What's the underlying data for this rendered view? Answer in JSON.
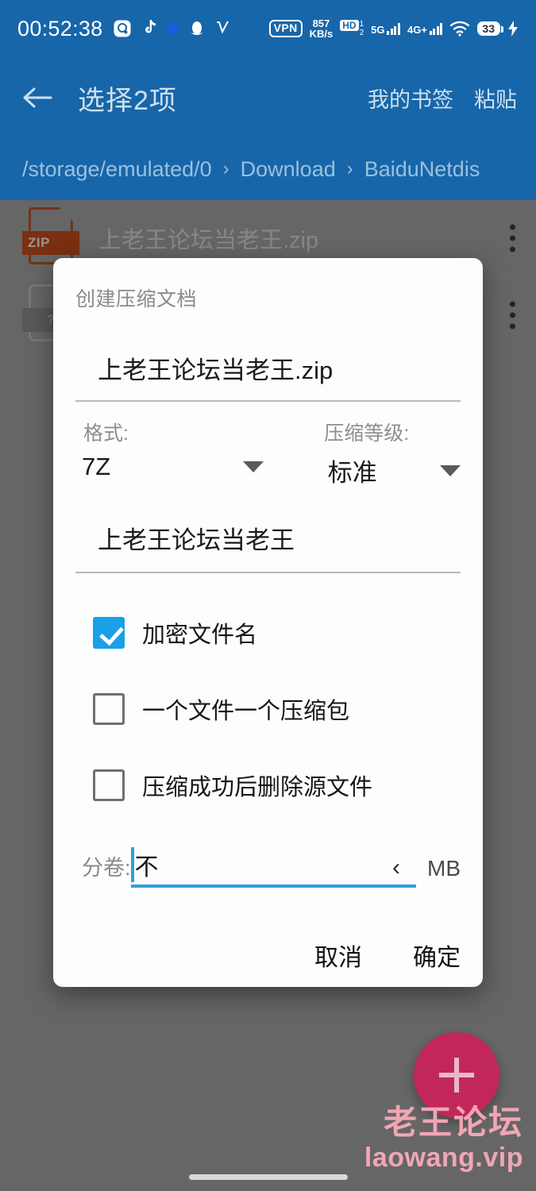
{
  "statusbar": {
    "time": "00:52:38",
    "left_icons": [
      "camera-app-icon",
      "tiktok-icon",
      "dot-badge-icon",
      "qq-icon",
      "v-app-icon"
    ],
    "vpn": "VPN",
    "netspeed_value": "857",
    "netspeed_unit": "KB/s",
    "hd_label": "HD",
    "hd_sup": "1",
    "hd_sub": "2",
    "sim1_label": "5G",
    "sim2_label": "4G+",
    "wifi_icon": "wifi-icon",
    "battery": "33",
    "charging_icon": "bolt-icon"
  },
  "appbar": {
    "back_icon": "back-arrow-icon",
    "title": "选择2项",
    "actions": [
      "我的书签",
      "粘贴"
    ]
  },
  "breadcrumb": {
    "separator": "›",
    "items": [
      "/storage/emulated/0",
      "Download",
      "BaiduNetdis"
    ]
  },
  "filelist": {
    "rows": [
      {
        "name": "上老王论坛当老王.zip",
        "icon": "zip-file-icon",
        "icon_tag": "ZIP",
        "menu_icon": "overflow-menu-icon"
      },
      {
        "name": "",
        "icon": "unknown-file-icon",
        "icon_tag": "?",
        "menu_icon": "overflow-menu-icon"
      }
    ]
  },
  "fab": {
    "icon": "plus-icon",
    "color": "#c2275c"
  },
  "watermark": {
    "cn": "老王论坛",
    "en": "laowang.vip",
    "color": "#f0a6b4"
  },
  "dialog": {
    "title": "创建压缩文档",
    "archive_name": "上老王论坛当老王.zip",
    "archive_name_placeholder": "",
    "format": {
      "label": "格式:",
      "value": "7Z",
      "caret_icon": "chevron-down-icon"
    },
    "level": {
      "label": "压缩等级:",
      "value": "标准",
      "caret_icon": "chevron-down-icon"
    },
    "password": {
      "value": "上老王论坛当老王",
      "placeholder": ""
    },
    "checkboxes": [
      {
        "label": "加密文件名",
        "checked": true
      },
      {
        "label": "一个文件一个压缩包",
        "checked": false
      },
      {
        "label": "压缩成功后删除源文件",
        "checked": false
      }
    ],
    "split": {
      "label": "分卷:",
      "value": "不",
      "chevron_icon": "chevron-left-icon",
      "unit": "MB"
    },
    "buttons": {
      "cancel": "取消",
      "confirm": "确定"
    }
  },
  "colors": {
    "appbar_blue": "#1766aa",
    "accent_blue": "#18a0e8",
    "fab_pink": "#c2275c",
    "zip_orange": "#d4541d"
  }
}
